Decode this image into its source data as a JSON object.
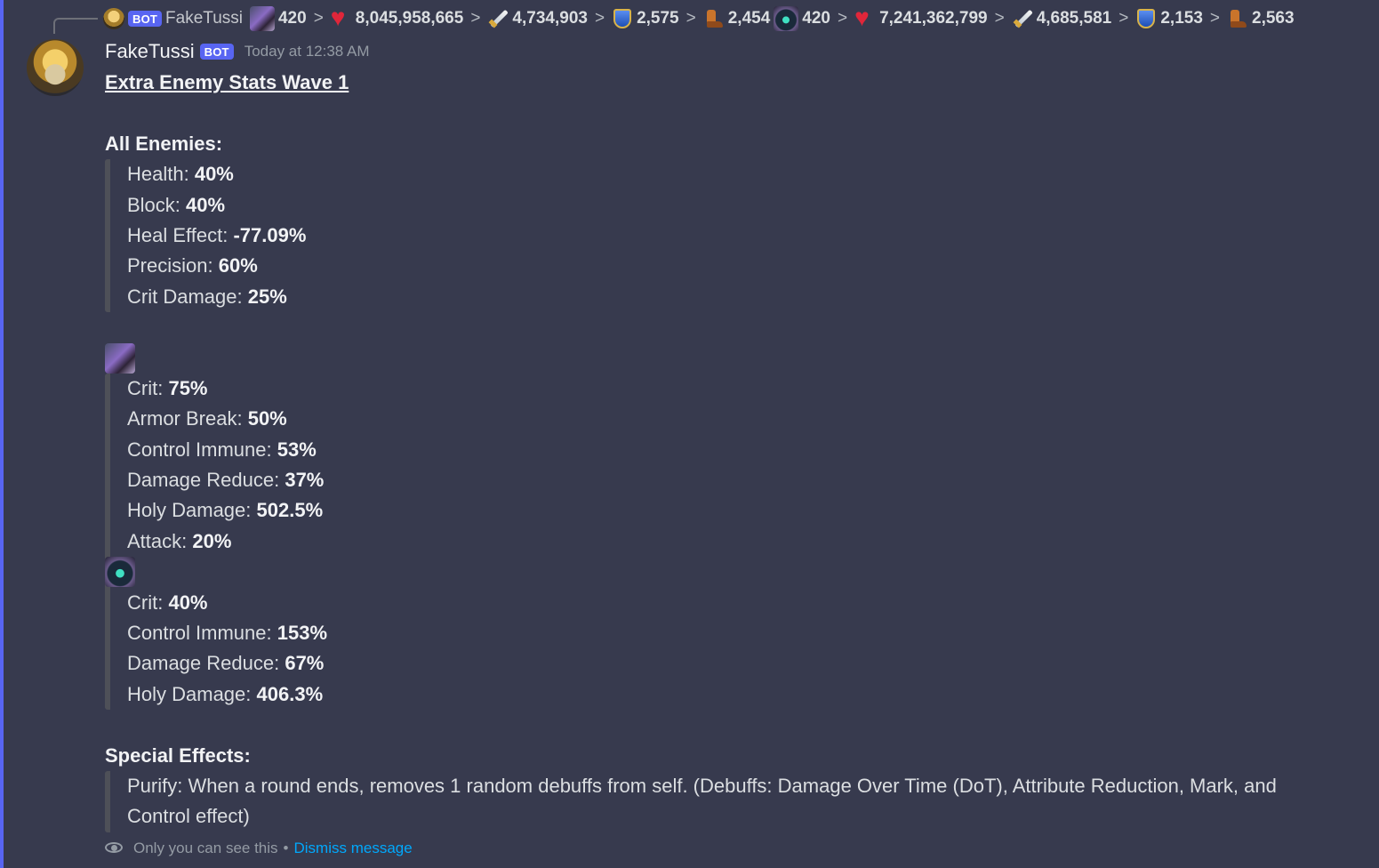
{
  "reply": {
    "author": "FakeTussi",
    "bot_tag": "BOT",
    "hero1": {
      "level": "420",
      "health": "8,045,958,665",
      "attack": "4,734,903",
      "armor": "2,575",
      "speed": "2,454"
    },
    "hero2": {
      "level": "420",
      "health": "7,241,362,799",
      "attack": "4,685,581",
      "armor": "2,153",
      "speed": "2,563"
    },
    "separator": ">"
  },
  "header": {
    "username": "FakeTussi",
    "bot_tag": "BOT",
    "timestamp": "Today at 12:38 AM"
  },
  "content": {
    "title": "Extra Enemy Stats Wave 1",
    "all_enemies_heading": "All Enemies:",
    "all_enemies": [
      {
        "label": "Health: ",
        "value": "40%"
      },
      {
        "label": "Block: ",
        "value": "40%"
      },
      {
        "label": "Heal Effect: ",
        "value": "-77.09%"
      },
      {
        "label": "Precision: ",
        "value": "60%"
      },
      {
        "label": "Crit Damage: ",
        "value": "25%"
      }
    ],
    "hero1_stats": [
      {
        "label": "Crit: ",
        "value": "75%"
      },
      {
        "label": "Armor Break: ",
        "value": "50%"
      },
      {
        "label": "Control Immune: ",
        "value": "53%"
      },
      {
        "label": "Damage Reduce: ",
        "value": "37%"
      },
      {
        "label": "Holy Damage: ",
        "value": "502.5%"
      },
      {
        "label": "Attack: ",
        "value": "20%"
      }
    ],
    "hero2_stats": [
      {
        "label": "Crit: ",
        "value": "40%"
      },
      {
        "label": "Control Immune: ",
        "value": "153%"
      },
      {
        "label": "Damage Reduce: ",
        "value": "67%"
      },
      {
        "label": "Holy Damage: ",
        "value": "406.3%"
      }
    ],
    "special_heading": "Special Effects:",
    "special_effect": "Purify: When a round ends, removes 1 random debuffs from self. (Debuffs: Damage Over Time (DoT), Attribute Reduction, Mark, and Control effect)"
  },
  "footer": {
    "only_you": "Only you can see this",
    "bullet": "•",
    "dismiss": "Dismiss message"
  },
  "colors": {
    "background": "#373a4e",
    "accent_border": "#5865f2",
    "link": "#00a8fc"
  },
  "icons": [
    "heart-icon",
    "sword-icon",
    "shield-icon",
    "boot-icon",
    "eye-icon"
  ]
}
